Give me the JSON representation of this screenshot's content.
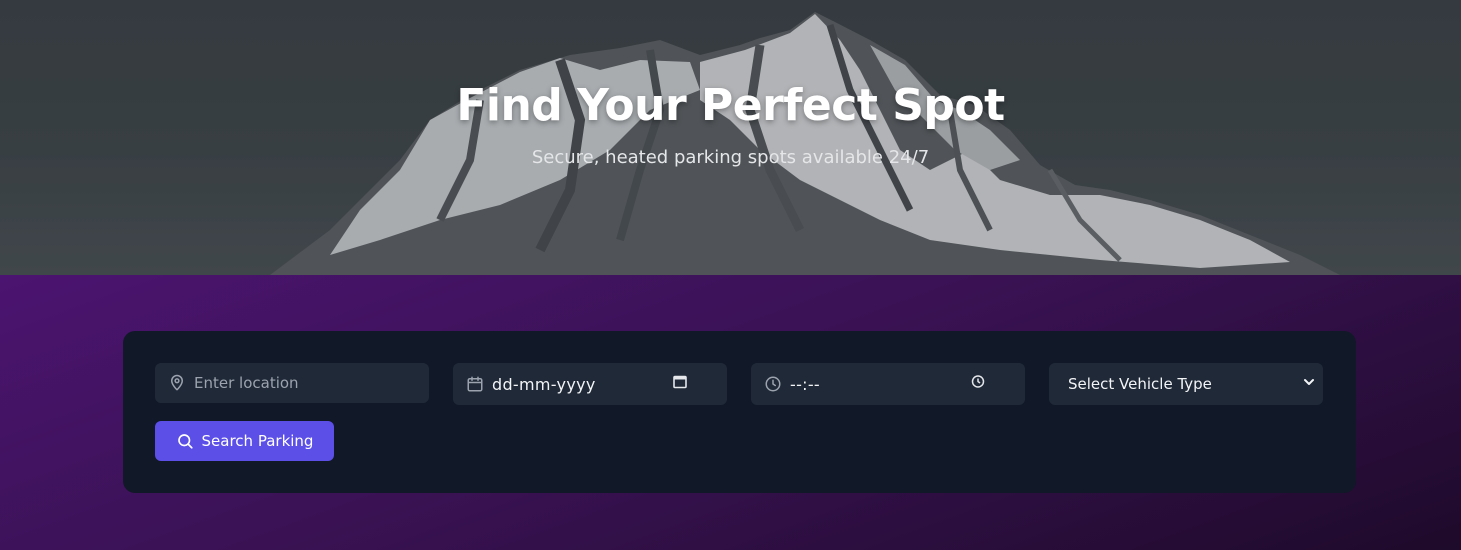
{
  "hero": {
    "title": "Find Your Perfect Spot",
    "subtitle": "Secure, heated parking spots available 24/7",
    "background_image": "snowy-mountain-peak"
  },
  "search": {
    "location_placeholder": "Enter location",
    "date_value": "dd-mm-yyyy",
    "time_value": "--:--",
    "vehicle_selected": "Select Vehicle Type",
    "button_label": "Search Parking"
  },
  "icons": {
    "location": "map-pin-icon",
    "date": "calendar-icon",
    "time": "clock-icon",
    "search": "search-icon"
  },
  "colors": {
    "accent": "#5b4fe8",
    "card_bg": "#111827",
    "field_bg": "#1f2937",
    "section_gradient_start": "#4b1470",
    "section_gradient_end": "#1e0a2a"
  }
}
